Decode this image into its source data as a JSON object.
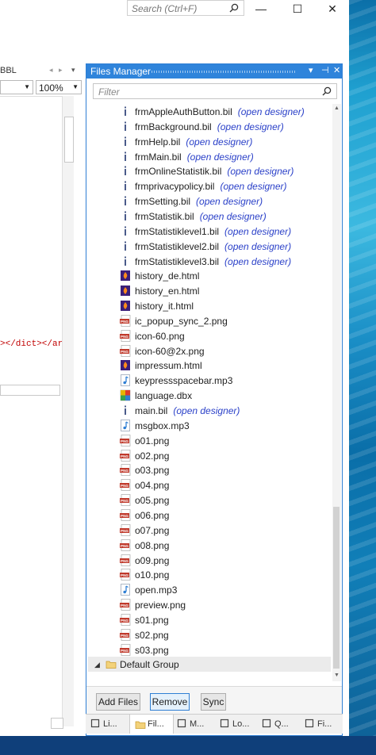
{
  "titlebar": {
    "search_placeholder": "Search (Ctrl+F)",
    "minimize": "—",
    "maximize": "☐",
    "close": "✕"
  },
  "left_pane": {
    "tab_label": "BBL",
    "zoom_value": "100%",
    "code_text": "></dict></ar"
  },
  "files_manager": {
    "title": "Files Manager",
    "filter_placeholder": "Filter",
    "open_designer": "(open designer)",
    "items": [
      {
        "name": "frmAppleAuthButton.bil",
        "icon": "bil-file-icon",
        "designer": true
      },
      {
        "name": "frmBackground.bil",
        "icon": "bil-file-icon",
        "designer": true
      },
      {
        "name": "frmHelp.bil",
        "icon": "bil-file-icon",
        "designer": true
      },
      {
        "name": "frmMain.bil",
        "icon": "bil-file-icon",
        "designer": true
      },
      {
        "name": "frmOnlineStatistik.bil",
        "icon": "bil-file-icon",
        "designer": true
      },
      {
        "name": "frmprivacypolicy.bil",
        "icon": "bil-file-icon",
        "designer": true
      },
      {
        "name": "frmSetting.bil",
        "icon": "bil-file-icon",
        "designer": true
      },
      {
        "name": "frmStatistik.bil",
        "icon": "bil-file-icon",
        "designer": true
      },
      {
        "name": "frmStatistiklevel1.bil",
        "icon": "bil-file-icon",
        "designer": true
      },
      {
        "name": "frmStatistiklevel2.bil",
        "icon": "bil-file-icon",
        "designer": true
      },
      {
        "name": "frmStatistiklevel3.bil",
        "icon": "bil-file-icon",
        "designer": true
      },
      {
        "name": "history_de.html",
        "icon": "html-file-icon",
        "designer": false
      },
      {
        "name": "history_en.html",
        "icon": "html-file-icon",
        "designer": false
      },
      {
        "name": "history_it.html",
        "icon": "html-file-icon",
        "designer": false
      },
      {
        "name": "ic_popup_sync_2.png",
        "icon": "png-file-icon",
        "designer": false
      },
      {
        "name": "icon-60.png",
        "icon": "png-file-icon",
        "designer": false
      },
      {
        "name": "icon-60@2x.png",
        "icon": "png-file-icon",
        "designer": false
      },
      {
        "name": "impressum.html",
        "icon": "html-file-icon",
        "designer": false
      },
      {
        "name": "keypressspacebar.mp3",
        "icon": "audio-file-icon",
        "designer": false
      },
      {
        "name": "language.dbx",
        "icon": "dbx-file-icon",
        "designer": false
      },
      {
        "name": "main.bil",
        "icon": "bil-file-icon",
        "designer": true
      },
      {
        "name": "msgbox.mp3",
        "icon": "audio-file-icon",
        "designer": false
      },
      {
        "name": "o01.png",
        "icon": "png-file-icon",
        "designer": false
      },
      {
        "name": "o02.png",
        "icon": "png-file-icon",
        "designer": false
      },
      {
        "name": "o03.png",
        "icon": "png-file-icon",
        "designer": false
      },
      {
        "name": "o04.png",
        "icon": "png-file-icon",
        "designer": false
      },
      {
        "name": "o05.png",
        "icon": "png-file-icon",
        "designer": false
      },
      {
        "name": "o06.png",
        "icon": "png-file-icon",
        "designer": false
      },
      {
        "name": "o07.png",
        "icon": "png-file-icon",
        "designer": false
      },
      {
        "name": "o08.png",
        "icon": "png-file-icon",
        "designer": false
      },
      {
        "name": "o09.png",
        "icon": "png-file-icon",
        "designer": false
      },
      {
        "name": "o10.png",
        "icon": "png-file-icon",
        "designer": false
      },
      {
        "name": "open.mp3",
        "icon": "audio-file-icon",
        "designer": false
      },
      {
        "name": "preview.png",
        "icon": "png-file-icon",
        "designer": false
      },
      {
        "name": "s01.png",
        "icon": "png-file-icon",
        "designer": false
      },
      {
        "name": "s02.png",
        "icon": "png-file-icon",
        "designer": false
      },
      {
        "name": "s03.png",
        "icon": "png-file-icon",
        "designer": false
      }
    ],
    "group": {
      "name": "Default Group",
      "icon": "folder-icon"
    },
    "buttons": {
      "add": "Add Files",
      "remove": "Remove",
      "sync": "Sync"
    }
  },
  "bottom_tabs": [
    {
      "label": "Li...",
      "icon": "library-icon"
    },
    {
      "label": "Fil...",
      "icon": "folder-icon"
    },
    {
      "label": "M...",
      "icon": "modules-icon"
    },
    {
      "label": "Lo...",
      "icon": "log-icon"
    },
    {
      "label": "Q...",
      "icon": "search-icon"
    },
    {
      "label": "Fi...",
      "icon": "find-icon"
    }
  ],
  "colors": {
    "accent": "#2f84db",
    "designer_link": "#2a40c8",
    "png_badge": "#c0392b"
  }
}
